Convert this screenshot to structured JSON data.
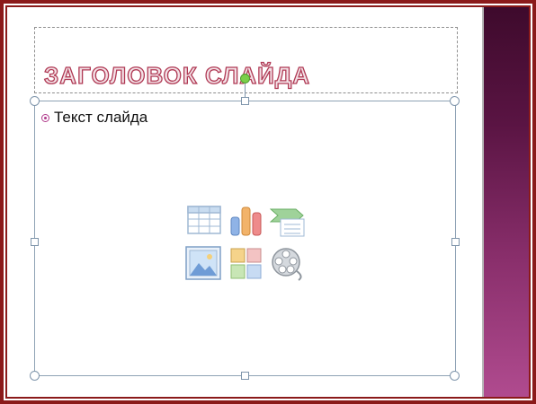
{
  "slide": {
    "title_placeholder": "ЗАГОЛОВОК СЛАЙДА",
    "content_placeholder_bullet": "Текст слайда"
  },
  "content_icons": [
    {
      "name": "insert-table-icon"
    },
    {
      "name": "insert-chart-icon"
    },
    {
      "name": "insert-smartart-icon"
    },
    {
      "name": "insert-picture-icon"
    },
    {
      "name": "insert-clipart-icon"
    },
    {
      "name": "insert-media-icon"
    }
  ],
  "colors": {
    "frame": "#8b1a1a",
    "title_outline": "#b03a55",
    "bullet": "#b03a8c",
    "selection": "#8fa2b5",
    "rotate_handle": "#7ad04a",
    "theme_band": "#8a2f6c"
  }
}
